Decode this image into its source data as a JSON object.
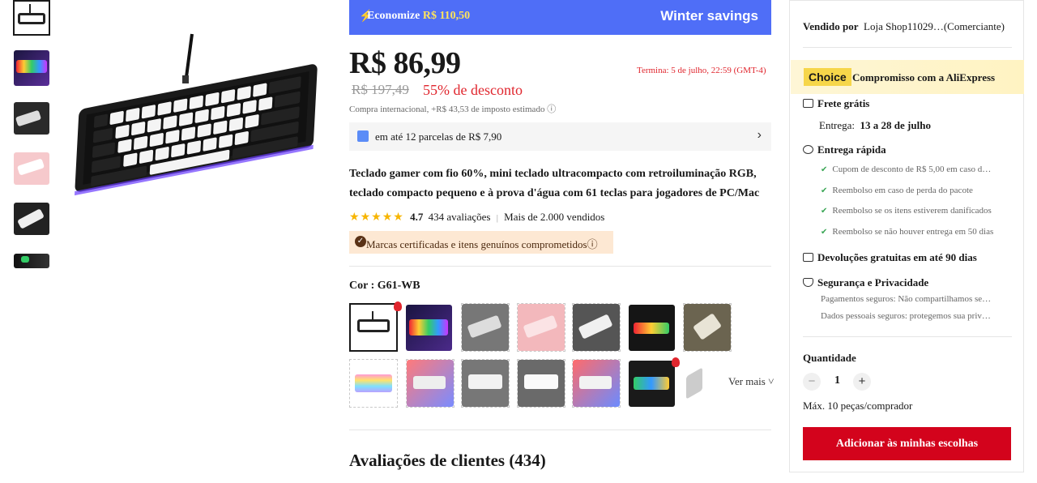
{
  "promo": {
    "save_prefix": "Economize ",
    "save_amount": "R$ 110,50",
    "campaign": "Winter savings",
    "bolt_icon": "lightning-icon"
  },
  "price": {
    "current": "R$ 86,99",
    "ends": "Termina: 5 de julho, 22:59 (GMT-4)",
    "original": "R$ 197,49",
    "discount": "55% de desconto",
    "tax_note": "Compra internacional, +R$ 43,53 de imposto estimado ⓘ"
  },
  "installments": {
    "text": "em até 12 parcelas de R$ 7,90",
    "arrow": "›"
  },
  "product": {
    "title": "Teclado gamer com fio 60%, mini teclado ultracompacto com retroiluminação RGB, teclado compacto pequeno e à prova d'água com 61 teclas para jogadores de PC/Mac",
    "rating": 4.7,
    "rating_text": "4.7",
    "reviews_count": "434 avaliações",
    "separator": "|",
    "sold": "Mais de 2.000 vendidos",
    "badge": "Marcas certificadas e itens genuínos comprometidos",
    "badge_info": "ⓘ",
    "color_label": "Cor : G61-WB",
    "see_more": "Ver mais ˅",
    "reviews_heading": "Avaliações de clientes (434)"
  },
  "panel": {
    "seller_label": "Vendido por",
    "seller_name": "Loja Shop11029…(Comerciante)",
    "choice_tag": "Choice",
    "choice_text": "Compromisso com a AliExpress",
    "free_shipping": "Frete grátis",
    "delivery_label": "Entrega:",
    "delivery_dates": "13 a 28 de julho",
    "fast_delivery": "Entrega rápida",
    "fast_items": [
      "Cupom de desconto de R$ 5,00 em caso d…",
      "Reembolso em caso de perda do pacote",
      "Reembolso se os itens estiverem danificados",
      "Reembolso se não houver entrega em 50 dias"
    ],
    "returns": "Devoluções gratuitas em até 90 dias",
    "security": "Segurança e Privacidade",
    "security_items": [
      "Pagamentos seguros: Não compartilhamos se…",
      "Dados pessoais seguros: protegemos sua priv…"
    ],
    "quantity_label": "Quantidade",
    "quantity": "1",
    "minus": "−",
    "plus": "+",
    "max_per_buyer": "Máx. 10 peças/comprador",
    "add_button": "Adicionar às minhas escolhas"
  },
  "colors": {
    "accent_red": "#d3031c",
    "promo_blue": "#4f6ef7",
    "choice_yellow": "#f6d64a"
  }
}
